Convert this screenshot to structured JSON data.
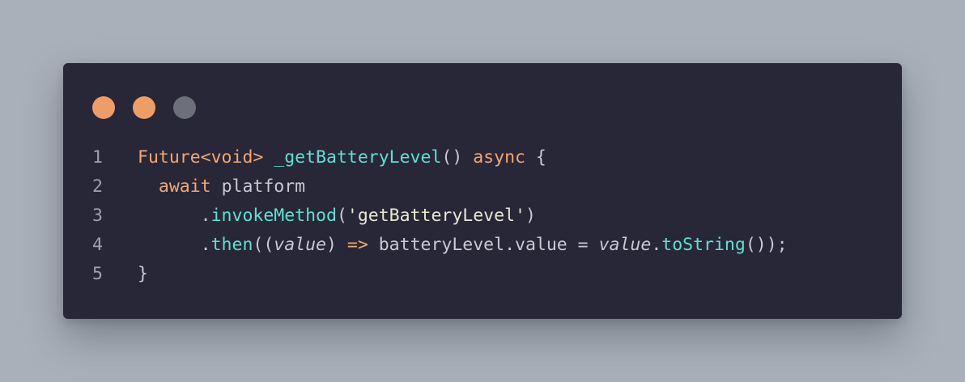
{
  "window_controls": {
    "close_color": "#EE9D67",
    "minimize_color": "#EE9D67",
    "maximize_color": "#6D6F79"
  },
  "colors": {
    "background": "#A8B0B9",
    "editor": "#282737",
    "keyword": "#F2A773",
    "function": "#5EE0D6",
    "text": "#C9C8D3",
    "line_number": "#A1A0AC"
  },
  "code": {
    "lines": [
      {
        "number": "1",
        "tokens": [
          {
            "text": "Future<",
            "kind": "keyword"
          },
          {
            "text": "void",
            "kind": "keyword"
          },
          {
            "text": "> ",
            "kind": "keyword"
          },
          {
            "text": "_getBatteryLevel",
            "kind": "function"
          },
          {
            "text": "() ",
            "kind": "plain"
          },
          {
            "text": "async",
            "kind": "keyword"
          },
          {
            "text": " {",
            "kind": "plain"
          }
        ]
      },
      {
        "number": "2",
        "tokens": [
          {
            "text": "  ",
            "kind": "plain"
          },
          {
            "text": "await",
            "kind": "keyword"
          },
          {
            "text": " platform",
            "kind": "plain"
          }
        ]
      },
      {
        "number": "3",
        "tokens": [
          {
            "text": "      .",
            "kind": "plain"
          },
          {
            "text": "invokeMethod",
            "kind": "function"
          },
          {
            "text": "(",
            "kind": "plain"
          },
          {
            "text": "'getBatteryLevel'",
            "kind": "string"
          },
          {
            "text": ")",
            "kind": "plain"
          }
        ]
      },
      {
        "number": "4",
        "tokens": [
          {
            "text": "      .",
            "kind": "plain"
          },
          {
            "text": "then",
            "kind": "function"
          },
          {
            "text": "((",
            "kind": "plain"
          },
          {
            "text": "value",
            "kind": "param"
          },
          {
            "text": ") ",
            "kind": "plain"
          },
          {
            "text": "=>",
            "kind": "keyword"
          },
          {
            "text": " batteryLevel.value = ",
            "kind": "plain"
          },
          {
            "text": "value",
            "kind": "param"
          },
          {
            "text": ".",
            "kind": "plain"
          },
          {
            "text": "toString",
            "kind": "function"
          },
          {
            "text": "());",
            "kind": "plain"
          }
        ]
      },
      {
        "number": "5",
        "tokens": [
          {
            "text": "}",
            "kind": "plain"
          }
        ]
      }
    ]
  }
}
